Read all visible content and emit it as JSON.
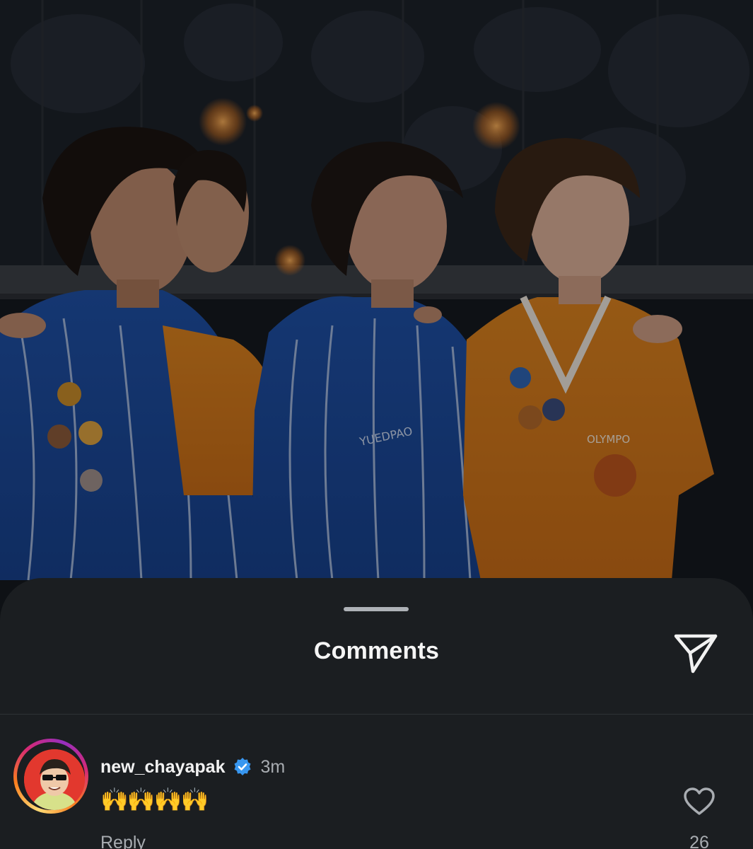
{
  "photo": {
    "description_icon": "photo-group-image",
    "jacket_text": "YUEDPAO",
    "shirt_text": "OLYMPO"
  },
  "sheet": {
    "title": "Comments",
    "share_icon": "send-icon"
  },
  "comment": {
    "username": "new_chayapak",
    "verified_icon": "verified-badge-icon",
    "time": "3m",
    "text": "🙌🙌🙌🙌",
    "reply_label": "Reply",
    "like_icon": "heart-icon",
    "like_count": "26"
  },
  "colors": {
    "sheet_bg": "#1b1e21",
    "verified_blue": "#3897f0",
    "muted_text": "#a8acb1"
  }
}
